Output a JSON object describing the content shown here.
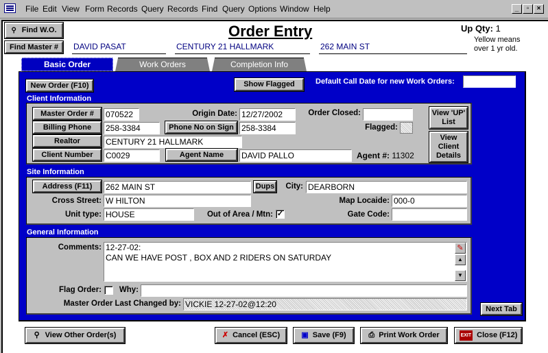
{
  "menubar": {
    "items": [
      "File",
      "Edit",
      "View",
      "Form",
      "Records",
      "Query",
      "Records",
      "Find",
      "Query",
      "Options",
      "Window",
      "Help"
    ]
  },
  "window_controls": {
    "minimize": "_",
    "restore": "▫",
    "close": "×"
  },
  "header": {
    "title": "Order Entry",
    "find_wo_label": "Find W.O.",
    "find_master_label": "Find Master #",
    "client_name": "DAVID PASAT",
    "realtor_name": "CENTURY 21 HALLMARK",
    "address": "262 MAIN ST",
    "up_qty_label": "Up Qty:",
    "up_qty_value": "1",
    "yellow_note_line1": "Yellow means",
    "yellow_note_line2": "over 1 yr old."
  },
  "tabs": [
    {
      "label": "Basic Order",
      "active": true
    },
    {
      "label": "Work Orders",
      "active": false
    },
    {
      "label": "Completion Info",
      "active": false
    }
  ],
  "toolbar": {
    "new_order": "New Order  (F10)",
    "show_flagged": "Show Flagged",
    "default_call_date_label": "Default Call Date for new Work Orders:",
    "default_call_date_value": ""
  },
  "client": {
    "section_title": "Client Information",
    "master_order_btn": "Master Order #",
    "master_order": "070522",
    "origin_date_label": "Origin Date:",
    "origin_date": "12/27/2002",
    "order_closed_label": "Order Closed:",
    "order_closed": "",
    "billing_phone_btn": "Billing Phone",
    "billing_phone": "258-3384",
    "phone_sign_btn": "Phone No on Sign",
    "phone_sign": "258-3384",
    "flagged_label": "Flagged:",
    "realtor_btn": "Realtor",
    "realtor": "CENTURY 21 HALLMARK",
    "client_number_btn": "Client Number",
    "client_number": "C0029",
    "agent_name_btn": "Agent Name",
    "agent_name": "DAVID PALLO",
    "agent_num_label": "Agent #:",
    "agent_num": "11302",
    "view_up_list": "View 'UP' List",
    "view_client_details": "View Client Details"
  },
  "site": {
    "section_title": "Site Information",
    "address_btn": "Address  (F11)",
    "address": "262 MAIN ST",
    "dups_btn": "Dups",
    "city_label": "City:",
    "city": "DEARBORN",
    "cross_street_label": "Cross Street:",
    "cross_street": "W HILTON",
    "map_label": "Map Locaide:",
    "map": "000-0",
    "unit_type_label": "Unit type:",
    "unit_type": "HOUSE",
    "out_of_area_label": "Out of Area / Mtn:",
    "out_of_area_checked": true,
    "gate_code_label": "Gate Code:",
    "gate_code": ""
  },
  "general": {
    "section_title": "General Information",
    "comments_label": "Comments:",
    "comments_line1": "12-27-02:",
    "comments_line2": "CAN WE HAVE POST , BOX AND 2 RIDERS ON SATURDAY",
    "flag_order_label": "Flag Order:",
    "flag_order_checked": false,
    "why_label": "Why:",
    "why": "",
    "last_changed_label": "Master Order Last Changed by:",
    "last_changed": "VICKIE 12-27-02@12:20"
  },
  "next_tab": "Next Tab",
  "footer": {
    "view_other": "View Other Order(s)",
    "cancel": "Cancel  (ESC)",
    "save": "Save  (F9)",
    "print": "Print Work Order",
    "close": "Close  (F12)"
  }
}
